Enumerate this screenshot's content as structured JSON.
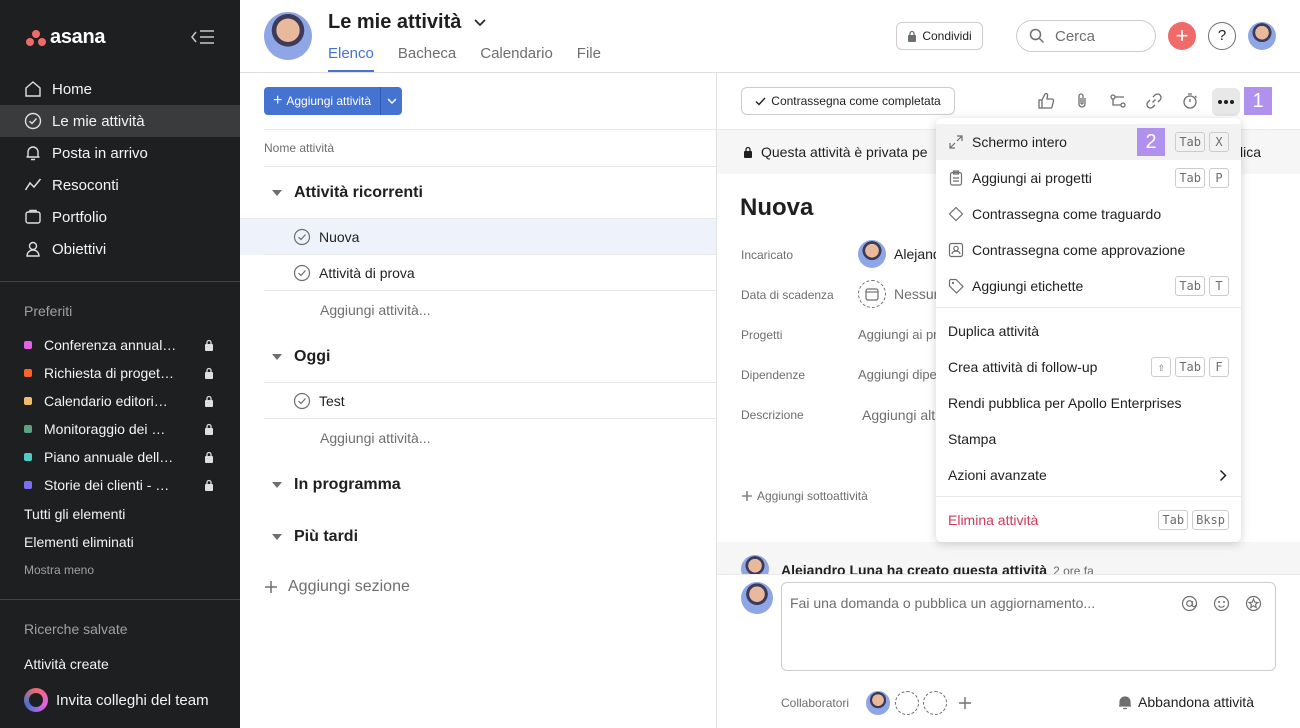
{
  "sidebar": {
    "logo_text": "asana",
    "nav": [
      {
        "label": "Home",
        "icon": "home-icon"
      },
      {
        "label": "Le mie attività",
        "icon": "check-circle-icon"
      },
      {
        "label": "Posta in arrivo",
        "icon": "bell-icon"
      },
      {
        "label": "Resoconti",
        "icon": "chart-line-icon"
      },
      {
        "label": "Portfolio",
        "icon": "folder-icon"
      },
      {
        "label": "Obiettivi",
        "icon": "person-icon"
      }
    ],
    "favorites_title": "Preferiti",
    "favorites": [
      {
        "label": "Conferenza annual…",
        "color": "#e362e3"
      },
      {
        "label": "Richiesta di proget…",
        "color": "#fd612c"
      },
      {
        "label": "Calendario editori…",
        "color": "#f1bd6c"
      },
      {
        "label": "Monitoraggio dei …",
        "color": "#5da283"
      },
      {
        "label": "Piano annuale dell…",
        "color": "#4ecbc4"
      },
      {
        "label": "Storie dei clienti - …",
        "color": "#7a6ff0"
      }
    ],
    "all_items": "Tutti gli elementi",
    "deleted_items": "Elementi eliminati",
    "show_less": "Mostra meno",
    "saved_searches_title": "Ricerche salvate",
    "created_tasks": "Attività create",
    "invite": "Invita colleghi del team"
  },
  "header": {
    "title": "Le mie attività",
    "tabs": [
      "Elenco",
      "Bacheca",
      "Calendario",
      "File"
    ],
    "share_label": "Condividi",
    "search_placeholder": "Cerca",
    "help_label": "?"
  },
  "list": {
    "add_task_label": "Aggiungi attività",
    "column_header": "Nome attività",
    "sections": [
      {
        "name": "Attività ricorrenti",
        "tasks": [
          "Nuova",
          "Attività di prova"
        ]
      },
      {
        "name": "Oggi",
        "tasks": [
          "Test"
        ]
      },
      {
        "name": "In programma",
        "tasks": []
      },
      {
        "name": "Più tardi",
        "tasks": []
      }
    ],
    "add_task_row": "Aggiungi attività...",
    "add_section": "Aggiungi sezione"
  },
  "detail": {
    "mark_complete": "Contrassegna come completata",
    "private_notice": "Questa attività è privata pe",
    "private_suffix": "lica",
    "task_title": "Nuova",
    "fields": [
      {
        "label": "Incaricato",
        "value": "Alejand"
      },
      {
        "label": "Data di scadenza",
        "value": "Nessun"
      },
      {
        "label": "Progetti",
        "value": "Aggiungi ai pr"
      },
      {
        "label": "Dipendenze",
        "value": "Aggiungi dipe"
      },
      {
        "label": "Descrizione",
        "value": "Aggiungi alt"
      }
    ],
    "add_subtask": "Aggiungi sottoattività",
    "activity_text": "Alejandro Luna ha creato questa attività",
    "activity_time": "2 ore fa",
    "comment_placeholder": "Fai una domanda o pubblica un aggiornamento...",
    "collaborators_label": "Collaboratori",
    "leave_task": "Abbandona attività"
  },
  "badges": {
    "one": "1",
    "two": "2"
  },
  "menu": {
    "items": [
      {
        "label": "Schermo intero",
        "icon": "expand-icon",
        "keys": [
          "Tab",
          "X"
        ]
      },
      {
        "label": "Aggiungi ai progetti",
        "icon": "clipboard-icon",
        "keys": [
          "Tab",
          "P"
        ]
      },
      {
        "label": "Contrassegna come traguardo",
        "icon": "diamond-icon",
        "keys": []
      },
      {
        "label": "Contrassegna come approvazione",
        "icon": "approval-icon",
        "keys": []
      },
      {
        "label": "Aggiungi etichette",
        "icon": "tag-icon",
        "keys": [
          "Tab",
          "T"
        ]
      },
      {
        "label": "Duplica attività",
        "keys": []
      },
      {
        "label": "Crea attività di follow-up",
        "keys": [
          "⇧",
          "Tab",
          "F"
        ]
      },
      {
        "label": "Rendi pubblica per Apollo Enterprises",
        "keys": []
      },
      {
        "label": "Stampa",
        "keys": []
      },
      {
        "label": "Azioni avanzate",
        "keys": []
      },
      {
        "label": "Elimina attività",
        "keys": [
          "Tab",
          "Bksp"
        ]
      }
    ]
  },
  "colors": {
    "accent": "#4573d2",
    "brand": "#f06a6a",
    "danger": "#d1395a",
    "badge": "#b091ee",
    "sidebar": "#1e1f21"
  }
}
